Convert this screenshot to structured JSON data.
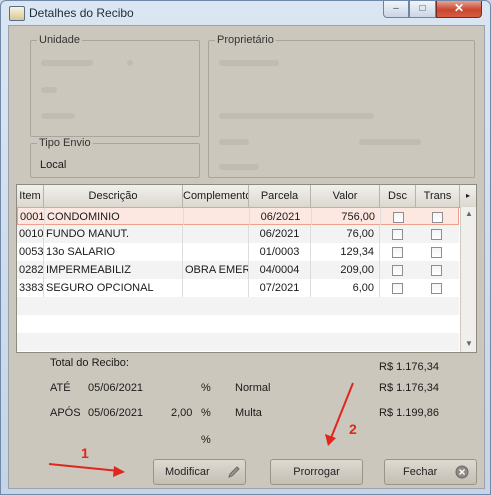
{
  "window": {
    "title": "Detalhes do Recibo",
    "minimize": "–",
    "maximize": "□",
    "close": "✕"
  },
  "groups": {
    "unidade": "Unidade",
    "proprietario": "Proprietário",
    "tipo_envio": "Tipo Envio"
  },
  "tipo_envio_value": "Local",
  "table": {
    "headers": [
      "Item",
      "Descrição",
      "Complemento",
      "Parcela",
      "Valor",
      "Dsc",
      "Trans"
    ],
    "rows": [
      {
        "item": "0001",
        "descricao": "CONDOMINIO",
        "complemento": "",
        "parcela": "06/2021",
        "valor": "756,00"
      },
      {
        "item": "0010",
        "descricao": "FUNDO MANUT.",
        "complemento": "",
        "parcela": "06/2021",
        "valor": "76,00"
      },
      {
        "item": "0053",
        "descricao": "13o SALARIO",
        "complemento": "",
        "parcela": "01/0003",
        "valor": "129,34"
      },
      {
        "item": "0282",
        "descricao": "IMPERMEABILIZ",
        "complemento": "OBRA EMERG",
        "parcela": "04/0004",
        "valor": "209,00"
      },
      {
        "item": "3383",
        "descricao": "SEGURO OPCIONAL",
        "complemento": "",
        "parcela": "07/2021",
        "valor": "6,00"
      }
    ]
  },
  "totals": {
    "label": "Total do Recibo:",
    "total_value": "R$ 1.176,34",
    "ate_label": "ATÉ",
    "ate_date": "05/06/2021",
    "ate_pct": "%",
    "ate_type": "Normal",
    "ate_value": "R$ 1.176,34",
    "apos_label": "APÓS",
    "apos_date": "05/06/2021",
    "apos_rate": "2,00",
    "apos_pct": "%",
    "apos_type": "Multa",
    "apos_value": "R$ 1.199,86",
    "extra_pct": "%"
  },
  "buttons": {
    "modificar": "Modificar",
    "prorrogar": "Prorrogar",
    "fechar": "Fechar"
  },
  "annotations": {
    "one": "1",
    "two": "2"
  },
  "colors": {
    "annotation_red": "#e0261d",
    "selected_row_border": "#f0a08a"
  },
  "icons": [
    "app-icon",
    "pencil-icon",
    "close-circle-icon",
    "scroll-up-icon",
    "scroll-down-icon",
    "scroll-right-icon"
  ]
}
